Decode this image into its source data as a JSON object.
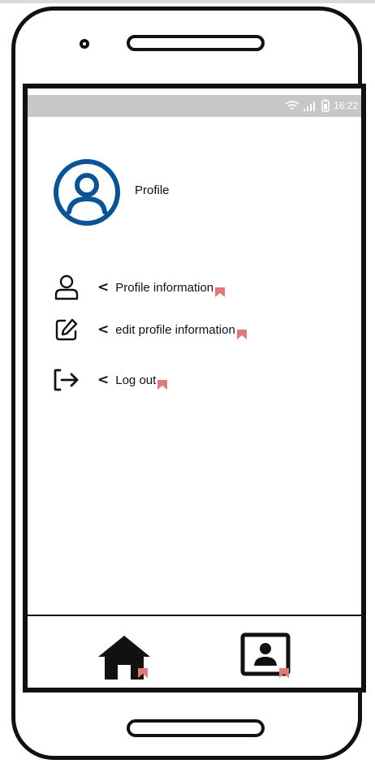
{
  "status_bar": {
    "time": "16:22",
    "icons": [
      "wifi-icon",
      "signal-icon",
      "battery-icon"
    ]
  },
  "profile": {
    "title": "Profile",
    "avatar_icon": "user-circle-icon",
    "accent_color": "#0b5394"
  },
  "menu": {
    "items": [
      {
        "icon": "user-icon",
        "label": "Profile information"
      },
      {
        "icon": "edit-icon",
        "label": "edit profile information"
      },
      {
        "icon": "logout-icon",
        "label": "Log out"
      }
    ],
    "chevron": "<"
  },
  "bottom_nav": {
    "items": [
      {
        "icon": "home-icon"
      },
      {
        "icon": "contact-card-icon"
      }
    ]
  },
  "colors": {
    "link_marker": "#e07a7a",
    "status_bar_bg": "#c7c7c7"
  }
}
